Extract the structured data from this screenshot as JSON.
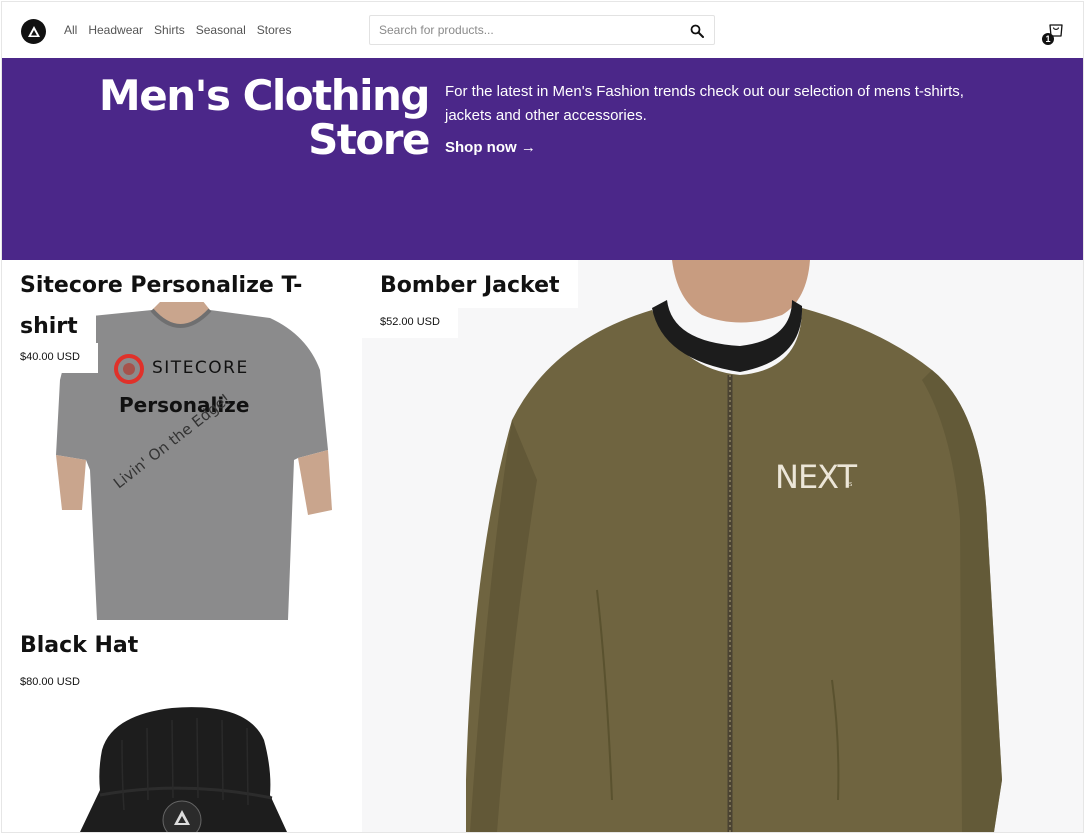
{
  "header": {
    "nav": [
      "All",
      "Headwear",
      "Shirts",
      "Seasonal",
      "Stores"
    ],
    "search_placeholder": "Search for products...",
    "cart_count": "1"
  },
  "hero": {
    "title_line1": "Men's Clothing",
    "title_line2": "Store",
    "description": "For the latest in Men's Fashion trends check out our selection of mens t-shirts, jackets and other accessories.",
    "cta": "Shop now →"
  },
  "products": [
    {
      "name_line1": "Sitecore Personalize T-",
      "name_line2": "shirt",
      "price": "$40.00 USD",
      "print_brand": "SITECORE",
      "print_title": "Personalize",
      "print_tagline": "Livin' On the Edge!"
    },
    {
      "name": "Bomber Jacket",
      "price": "$52.00 USD",
      "print_logo": "NEXT",
      "print_logo_sub": ".JS"
    },
    {
      "name": "Black Hat",
      "price": "$80.00 USD"
    }
  ],
  "colors": {
    "hero_bg": "#4b2789",
    "accent": "#111111"
  }
}
